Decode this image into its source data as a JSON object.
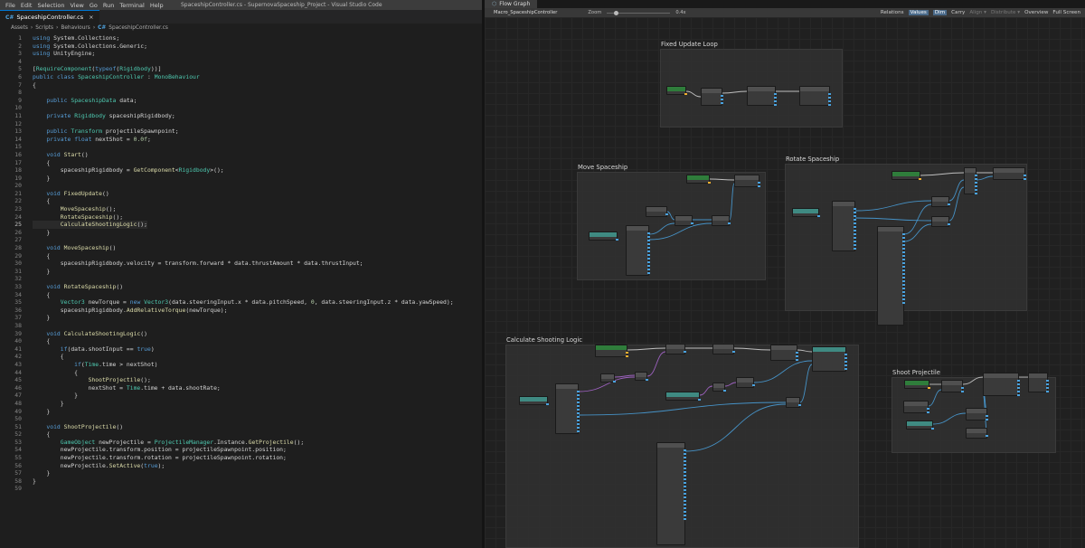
{
  "vscode": {
    "menu": [
      "File",
      "Edit",
      "Selection",
      "View",
      "Go",
      "Run",
      "Terminal",
      "Help"
    ],
    "window_title": "SpaceshipController.cs - SupernovaSpaceship_Project - Visual Studio Code",
    "tab": {
      "icon": "C#",
      "label": "SpaceshipController.cs",
      "close": "×"
    },
    "breadcrumb": [
      "Assets",
      "›",
      "Scripts",
      "›",
      "Behaviours",
      "›",
      "C#",
      "SpaceshipController.cs"
    ],
    "highlighted_line": 25,
    "lines": [
      "using System.Collections;",
      "using System.Collections.Generic;",
      "using UnityEngine;",
      "",
      "[RequireComponent(typeof(Rigidbody))]",
      "public class SpaceshipController : MonoBehaviour",
      "{",
      "",
      "    public SpaceshipData data;",
      "",
      "    private Rigidbody spaceshipRigidbody;",
      "",
      "    public Transform projectileSpawnpoint;",
      "    private float nextShot = 0.0f;",
      "",
      "    void Start()",
      "    {",
      "        spaceshipRigidbody = GetComponent<Rigidbody>();",
      "    }",
      "",
      "    void FixedUpdate()",
      "    {",
      "        MoveSpaceship();",
      "        RotateSpaceship();",
      "        CalculateShootingLogic();",
      "    }",
      "",
      "    void MoveSpaceship()",
      "    {",
      "        spaceshipRigidbody.velocity = transform.forward * data.thrustAmount * data.thrustInput;",
      "    }",
      "",
      "    void RotateSpaceship()",
      "    {",
      "        Vector3 newTorque = new Vector3(data.steeringInput.x * data.pitchSpeed, 0, data.steeringInput.z * data.yawSpeed);",
      "        spaceshipRigidbody.AddRelativeTorque(newTorque);",
      "    }",
      "",
      "    void CalculateShootingLogic()",
      "    {",
      "        if(data.shootInput == true)",
      "        {",
      "            if(Time.time > nextShot)",
      "            {",
      "                ShootProjectile();",
      "                nextShot = Time.time + data.shootRate;",
      "            }",
      "        }",
      "    }",
      "",
      "    void ShootProjectile()",
      "    {",
      "        GameObject newProjectile = ProjectileManager.Instance.GetProjectile();",
      "        newProjectile.transform.position = projectileSpawnpoint.position;",
      "        newProjectile.transform.rotation = projectileSpawnpoint.rotation;",
      "        newProjectile.SetActive(true);",
      "    }",
      "}",
      ""
    ]
  },
  "unity": {
    "tab_icon": "flow-graph-icon",
    "tab_label": "Flow Graph",
    "macro": "Macro_SpaceshipController",
    "zoom_label": "Zoom",
    "zoom_value": "0.4x",
    "toolbar_right": [
      "Relations",
      "Values",
      "Dim",
      "Carry",
      "Align ▾",
      "Distribute ▾",
      "Overview",
      "Full Screen"
    ],
    "toolbar_active": [
      "Values",
      "Dim"
    ],
    "toolbar_disabled": [
      "Align ▾",
      "Distribute ▾"
    ],
    "groups": [
      {
        "id": "fixed",
        "title": "Fixed Update Loop"
      },
      {
        "id": "move",
        "title": "Move Spaceship"
      },
      {
        "id": "rotate",
        "title": "Rotate Spaceship"
      },
      {
        "id": "shoot",
        "title": "Calculate Shooting Logic"
      },
      {
        "id": "proj",
        "title": "Shoot Projectile"
      }
    ],
    "colors": {
      "event_header": "#2f7d3b",
      "teal_header": "#3f8a82",
      "wire_blue": "#4aa3e0",
      "wire_purple": "#b06ad8",
      "flow_wire": "#d8d8d8"
    }
  }
}
